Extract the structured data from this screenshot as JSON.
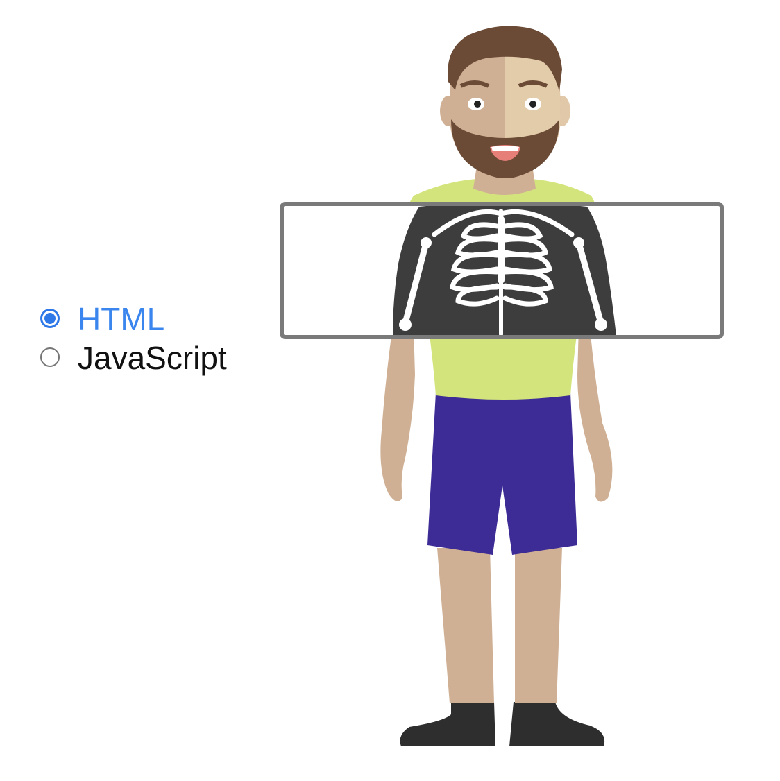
{
  "options": [
    {
      "label": "HTML",
      "checked": true
    },
    {
      "label": "JavaScript",
      "checked": false
    }
  ],
  "colors": {
    "accent": "#3b86ee",
    "radio_checked": "#2f78e8",
    "xray_frame": "#7a7a7a",
    "xray_background": "#3d3d3d",
    "bones": "#ffffff",
    "shirt": "#d4e47c",
    "shorts": "#3d2b96",
    "skin": "#cfb094",
    "hair": "#6b4a36",
    "shoes": "#2e2e2e"
  },
  "illustration": {
    "subject": "person-with-xray-overlay",
    "icon": "skeleton-icon"
  }
}
